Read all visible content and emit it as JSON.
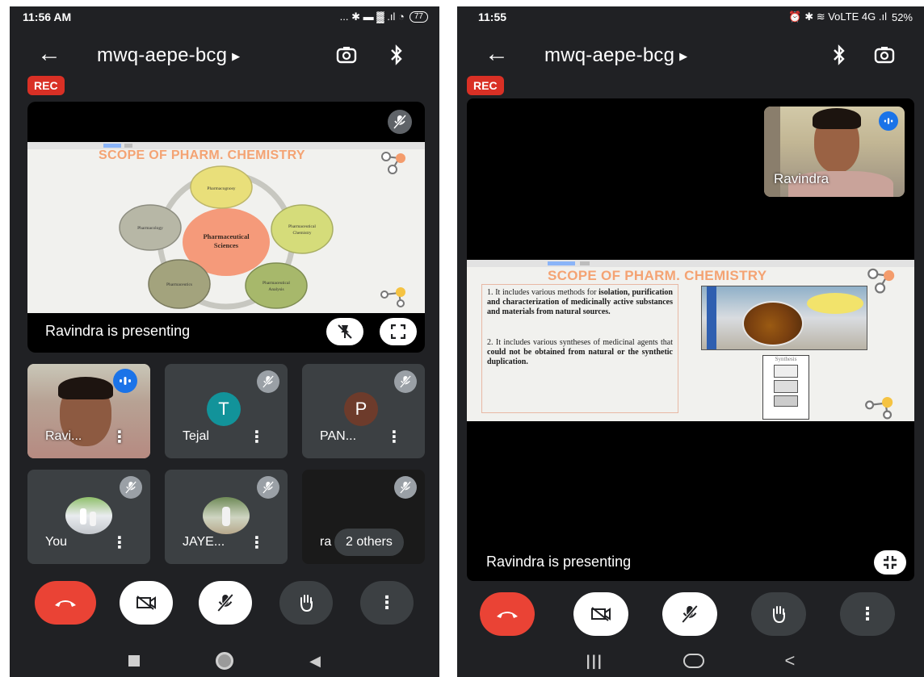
{
  "left": {
    "status": {
      "time": "11:56 AM",
      "icons": "... ✱ ▬ ▓ .ıl ◔",
      "battery": "77"
    },
    "meeting_code": "mwq-aepe-bcg",
    "rec_label": "REC",
    "slide": {
      "title": "SCOPE OF PHARM. CHEMISTRY",
      "center": "Pharmaceutical Sciences",
      "nodes": [
        "Pharmacognosy",
        "Pharmaceutical Chemistry",
        "Pharmaceutical Analysis",
        "Pharmaceutics",
        "Pharmacology"
      ]
    },
    "presenting_text": "Ravindra is presenting",
    "tiles": [
      {
        "name": "Ravi...",
        "kind": "video"
      },
      {
        "name": "Tejal",
        "initial": "T",
        "color": "#12939a"
      },
      {
        "name": "PAN...",
        "initial": "P",
        "color": "#6d3b2b"
      },
      {
        "name": "You",
        "kind": "photo"
      },
      {
        "name": "JAYE...",
        "kind": "photo"
      },
      {
        "name": "ra",
        "others": "2 others"
      }
    ]
  },
  "right": {
    "status": {
      "time": "11:55",
      "icons": "⏰ ✱ ≋ VoLTE 4G .ıl",
      "battery": "52%"
    },
    "meeting_code": "mwq-aepe-bcg",
    "rec_label": "REC",
    "self_view_name": "Ravindra",
    "slide": {
      "title": "SCOPE OF PHARM. CHEMISTRY",
      "point1_intro": "1. It includes various methods for",
      "point1_bold": "isolation, purification and characterization of medicinally active substances and materials from natural sources.",
      "point2_intro": "2. It includes various syntheses of medicinal agents that",
      "point2_bold": "could not be obtained from natural or the synthetic duplication.",
      "synthesis_label": "Synthesis"
    },
    "presenting_text": "Ravindra is presenting"
  },
  "colors": {
    "bg": "#202124",
    "tile": "#3c4043",
    "end_call": "#ea4335",
    "rec": "#d93025",
    "slide_title": "#f4a373"
  },
  "icons": [
    "back-arrow-icon",
    "switch-camera-icon",
    "bluetooth-icon",
    "mic-off-icon",
    "unpin-icon",
    "fullscreen-icon",
    "end-call-icon",
    "camera-off-icon",
    "raise-hand-icon",
    "more-icon",
    "exit-fullscreen-icon"
  ]
}
